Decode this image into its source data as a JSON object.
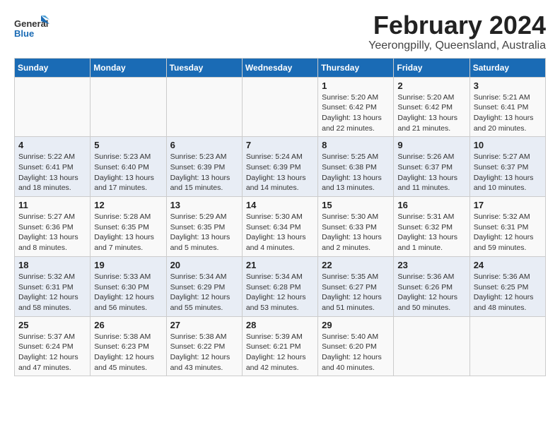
{
  "header": {
    "logo_general": "General",
    "logo_blue": "Blue",
    "title": "February 2024",
    "subtitle": "Yeerongpilly, Queensland, Australia"
  },
  "weekdays": [
    "Sunday",
    "Monday",
    "Tuesday",
    "Wednesday",
    "Thursday",
    "Friday",
    "Saturday"
  ],
  "weeks": [
    [
      {
        "day": "",
        "info": ""
      },
      {
        "day": "",
        "info": ""
      },
      {
        "day": "",
        "info": ""
      },
      {
        "day": "",
        "info": ""
      },
      {
        "day": "1",
        "info": "Sunrise: 5:20 AM\nSunset: 6:42 PM\nDaylight: 13 hours\nand 22 minutes."
      },
      {
        "day": "2",
        "info": "Sunrise: 5:20 AM\nSunset: 6:42 PM\nDaylight: 13 hours\nand 21 minutes."
      },
      {
        "day": "3",
        "info": "Sunrise: 5:21 AM\nSunset: 6:41 PM\nDaylight: 13 hours\nand 20 minutes."
      }
    ],
    [
      {
        "day": "4",
        "info": "Sunrise: 5:22 AM\nSunset: 6:41 PM\nDaylight: 13 hours\nand 18 minutes."
      },
      {
        "day": "5",
        "info": "Sunrise: 5:23 AM\nSunset: 6:40 PM\nDaylight: 13 hours\nand 17 minutes."
      },
      {
        "day": "6",
        "info": "Sunrise: 5:23 AM\nSunset: 6:39 PM\nDaylight: 13 hours\nand 15 minutes."
      },
      {
        "day": "7",
        "info": "Sunrise: 5:24 AM\nSunset: 6:39 PM\nDaylight: 13 hours\nand 14 minutes."
      },
      {
        "day": "8",
        "info": "Sunrise: 5:25 AM\nSunset: 6:38 PM\nDaylight: 13 hours\nand 13 minutes."
      },
      {
        "day": "9",
        "info": "Sunrise: 5:26 AM\nSunset: 6:37 PM\nDaylight: 13 hours\nand 11 minutes."
      },
      {
        "day": "10",
        "info": "Sunrise: 5:27 AM\nSunset: 6:37 PM\nDaylight: 13 hours\nand 10 minutes."
      }
    ],
    [
      {
        "day": "11",
        "info": "Sunrise: 5:27 AM\nSunset: 6:36 PM\nDaylight: 13 hours\nand 8 minutes."
      },
      {
        "day": "12",
        "info": "Sunrise: 5:28 AM\nSunset: 6:35 PM\nDaylight: 13 hours\nand 7 minutes."
      },
      {
        "day": "13",
        "info": "Sunrise: 5:29 AM\nSunset: 6:35 PM\nDaylight: 13 hours\nand 5 minutes."
      },
      {
        "day": "14",
        "info": "Sunrise: 5:30 AM\nSunset: 6:34 PM\nDaylight: 13 hours\nand 4 minutes."
      },
      {
        "day": "15",
        "info": "Sunrise: 5:30 AM\nSunset: 6:33 PM\nDaylight: 13 hours\nand 2 minutes."
      },
      {
        "day": "16",
        "info": "Sunrise: 5:31 AM\nSunset: 6:32 PM\nDaylight: 13 hours\nand 1 minute."
      },
      {
        "day": "17",
        "info": "Sunrise: 5:32 AM\nSunset: 6:31 PM\nDaylight: 12 hours\nand 59 minutes."
      }
    ],
    [
      {
        "day": "18",
        "info": "Sunrise: 5:32 AM\nSunset: 6:31 PM\nDaylight: 12 hours\nand 58 minutes."
      },
      {
        "day": "19",
        "info": "Sunrise: 5:33 AM\nSunset: 6:30 PM\nDaylight: 12 hours\nand 56 minutes."
      },
      {
        "day": "20",
        "info": "Sunrise: 5:34 AM\nSunset: 6:29 PM\nDaylight: 12 hours\nand 55 minutes."
      },
      {
        "day": "21",
        "info": "Sunrise: 5:34 AM\nSunset: 6:28 PM\nDaylight: 12 hours\nand 53 minutes."
      },
      {
        "day": "22",
        "info": "Sunrise: 5:35 AM\nSunset: 6:27 PM\nDaylight: 12 hours\nand 51 minutes."
      },
      {
        "day": "23",
        "info": "Sunrise: 5:36 AM\nSunset: 6:26 PM\nDaylight: 12 hours\nand 50 minutes."
      },
      {
        "day": "24",
        "info": "Sunrise: 5:36 AM\nSunset: 6:25 PM\nDaylight: 12 hours\nand 48 minutes."
      }
    ],
    [
      {
        "day": "25",
        "info": "Sunrise: 5:37 AM\nSunset: 6:24 PM\nDaylight: 12 hours\nand 47 minutes."
      },
      {
        "day": "26",
        "info": "Sunrise: 5:38 AM\nSunset: 6:23 PM\nDaylight: 12 hours\nand 45 minutes."
      },
      {
        "day": "27",
        "info": "Sunrise: 5:38 AM\nSunset: 6:22 PM\nDaylight: 12 hours\nand 43 minutes."
      },
      {
        "day": "28",
        "info": "Sunrise: 5:39 AM\nSunset: 6:21 PM\nDaylight: 12 hours\nand 42 minutes."
      },
      {
        "day": "29",
        "info": "Sunrise: 5:40 AM\nSunset: 6:20 PM\nDaylight: 12 hours\nand 40 minutes."
      },
      {
        "day": "",
        "info": ""
      },
      {
        "day": "",
        "info": ""
      }
    ]
  ]
}
